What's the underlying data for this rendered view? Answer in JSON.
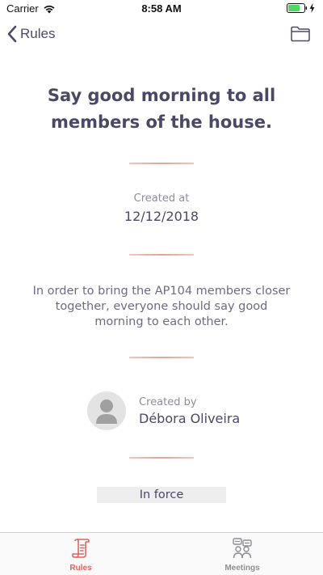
{
  "status_bar": {
    "carrier": "Carrier",
    "time": "8:58 AM",
    "battery_color": "#4cd964"
  },
  "nav": {
    "back_label": "Rules",
    "back_icon": "chevron-left-icon",
    "action_icon": "folder-icon"
  },
  "rule": {
    "title": "Say good morning to all members of the house.",
    "created_at_label": "Created at",
    "created_at": "12/12/2018",
    "description": "In order to bring the AP104 members closer together, everyone should say good morning to each other.",
    "created_by_label": "Created by",
    "author_name": "Débora Oliveira",
    "status": "In force"
  },
  "tabs": [
    {
      "label": "Rules",
      "icon": "scroll-document-icon",
      "active": true,
      "color": "#e0645c"
    },
    {
      "label": "Meetings",
      "icon": "meetings-icon",
      "active": false,
      "color": "#8e8e93"
    }
  ],
  "colors": {
    "accent": "#e0645c",
    "text": "#4a4866",
    "divider": "#e8a190"
  }
}
